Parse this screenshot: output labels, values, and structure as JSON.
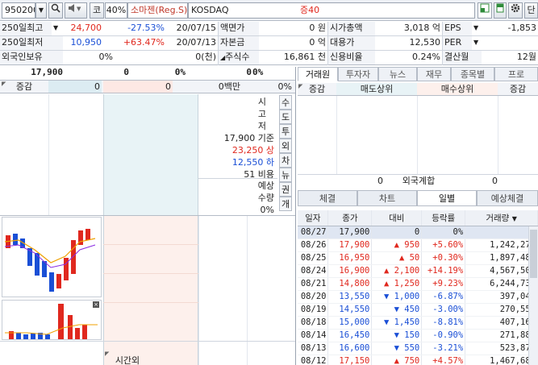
{
  "toolbar": {
    "code": "950200",
    "market_btn": "코",
    "pct": "40%",
    "stock_name": "소마젠(Reg.S)",
    "market": "KOSDAQ",
    "margin": "증40",
    "extra": "단"
  },
  "info": {
    "r1": {
      "l1": "250일최고",
      "v1": "24,700",
      "p1": "-27.53%",
      "d1": "20/07/15",
      "l2": "액면가",
      "v2": "0 원",
      "l3": "시가총액",
      "v3": "3,018 억",
      "l4": "EPS",
      "v4": "-1,853"
    },
    "r2": {
      "l1": "250일최저",
      "v1": "10,950",
      "p1": "+63.47%",
      "d1": "20/07/13",
      "l2": "자본금",
      "v2": "0 억",
      "l3": "대용가",
      "v3": "12,530",
      "l4": "PER",
      "v4": ""
    },
    "r3": {
      "l1": "외국인보유",
      "v1": "0%",
      "v1b": "0(천)",
      "l2": "주식수",
      "v2": "16,861 천",
      "l3": "신용비율",
      "v3": "0.24%",
      "l4": "결산월",
      "v4": "12월"
    }
  },
  "quote": {
    "price": "17,900",
    "q1": "0",
    "q2": "0%",
    "q3": "0",
    "q4": "0%",
    "hdr_change": "증감",
    "hdr_v1": "0",
    "hdr_v2": "0",
    "hdr_amount": "0백만",
    "hdr_pct": "0%"
  },
  "middle": {
    "labels": [
      "시",
      "고",
      "저"
    ],
    "base": "17,900 기준",
    "upper": "23,250 상",
    "lower": "12,550 하",
    "ratio": "51 비용",
    "expected": "예상",
    "qty": "수량",
    "qty_pct": "0%",
    "after": "시간외"
  },
  "side_buttons": [
    "수",
    "도",
    "투",
    "외",
    "차",
    "뉴",
    "권",
    "개"
  ],
  "broker": {
    "tabs": [
      "거래원",
      "투자자",
      "뉴스",
      "재무",
      "종목별",
      "프로"
    ],
    "headers": [
      "증감",
      "매도상위",
      "매수상위",
      "증감"
    ],
    "foreign_left": "0",
    "foreign_label": "외국계합",
    "foreign_right": "0"
  },
  "detail_tabs": [
    "체결",
    "차트",
    "일별",
    "예상체결"
  ],
  "daily": {
    "headers": [
      "일자",
      "종가",
      "대비",
      "등락률",
      "거래량"
    ],
    "rows": [
      {
        "date": "08/27",
        "close": "17,900",
        "dir": "",
        "chg": "0",
        "rate": "0%",
        "vol": "0"
      },
      {
        "date": "08/26",
        "close": "17,900",
        "dir": "up",
        "chg": "950",
        "rate": "+5.60%",
        "vol": "1,242,277"
      },
      {
        "date": "08/25",
        "close": "16,950",
        "dir": "up",
        "chg": "50",
        "rate": "+0.30%",
        "vol": "1,897,483"
      },
      {
        "date": "08/24",
        "close": "16,900",
        "dir": "up",
        "chg": "2,100",
        "rate": "+14.19%",
        "vol": "4,567,509"
      },
      {
        "date": "08/21",
        "close": "14,800",
        "dir": "up",
        "chg": "1,250",
        "rate": "+9.23%",
        "vol": "6,244,731"
      },
      {
        "date": "08/20",
        "close": "13,550",
        "dir": "down",
        "chg": "1,000",
        "rate": "-6.87%",
        "vol": "397,043"
      },
      {
        "date": "08/19",
        "close": "14,550",
        "dir": "down",
        "chg": "450",
        "rate": "-3.00%",
        "vol": "270,559"
      },
      {
        "date": "08/18",
        "close": "15,000",
        "dir": "down",
        "chg": "1,450",
        "rate": "-8.81%",
        "vol": "407,168"
      },
      {
        "date": "08/14",
        "close": "16,450",
        "dir": "down",
        "chg": "150",
        "rate": "-0.90%",
        "vol": "271,883"
      },
      {
        "date": "08/13",
        "close": "16,600",
        "dir": "down",
        "chg": "550",
        "rate": "-3.21%",
        "vol": "523,872"
      },
      {
        "date": "08/12",
        "close": "17,150",
        "dir": "up",
        "chg": "750",
        "rate": "+4.57%",
        "vol": "1,467,684"
      }
    ]
  },
  "colors": {
    "up": "#e0281e",
    "down": "#1a4fd6",
    "panel": "#eef1f6",
    "ask_bg": "#dcecf2",
    "bid_bg": "#fde8e4"
  }
}
